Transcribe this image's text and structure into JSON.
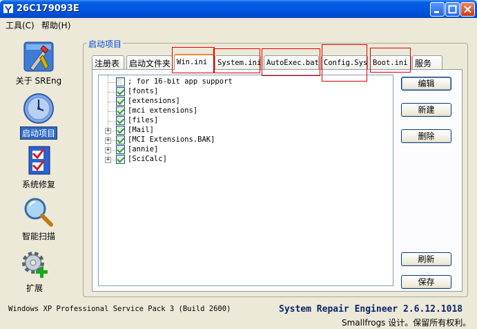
{
  "window": {
    "title": "26C179093E"
  },
  "menu": [
    "工具(C)",
    "帮助(H)"
  ],
  "sidebar": [
    {
      "label": "关于 SREng",
      "icon": "tools-icon"
    },
    {
      "label": "启动项目",
      "icon": "clock-icon",
      "selected": true
    },
    {
      "label": "系统修复",
      "icon": "checklist-icon"
    },
    {
      "label": "智能扫描",
      "icon": "magnifier-icon"
    },
    {
      "label": "扩展",
      "icon": "gear-plus-icon"
    }
  ],
  "group_title": "启动项目",
  "tabs": [
    "注册表",
    "启动文件夹",
    "Win.ini",
    "System.ini",
    "AutoExec.bat",
    "Config.Sys",
    "Boot.ini",
    "服务"
  ],
  "active_tab": "Win.ini",
  "tree": [
    {
      "text": "; for 16-bit app support",
      "checked": false,
      "expandable": false
    },
    {
      "text": "[fonts]",
      "checked": true,
      "expandable": false
    },
    {
      "text": "[extensions]",
      "checked": true,
      "expandable": false
    },
    {
      "text": "[mci extensions]",
      "checked": true,
      "expandable": false
    },
    {
      "text": "[files]",
      "checked": true,
      "expandable": false
    },
    {
      "text": "[Mail]",
      "checked": true,
      "expandable": true
    },
    {
      "text": "[MCI Extensions.BAK]",
      "checked": true,
      "expandable": true
    },
    {
      "text": "[annie]",
      "checked": true,
      "expandable": true
    },
    {
      "text": "[SciCalc]",
      "checked": true,
      "expandable": true
    }
  ],
  "buttons": {
    "edit": "编辑",
    "new": "新建",
    "delete": "删除",
    "refresh": "刷新",
    "save": "保存"
  },
  "status": {
    "os": "Windows XP Professional Service Pack 3 (Build 2600)",
    "product": "System Repair Engineer 2.6.12.1018",
    "copyright": "Smallfrogs 设计。保留所有权利。"
  },
  "colors": {
    "titlebar": "#0054e3",
    "highlight": "#e00000",
    "selection": "#316ac5"
  }
}
